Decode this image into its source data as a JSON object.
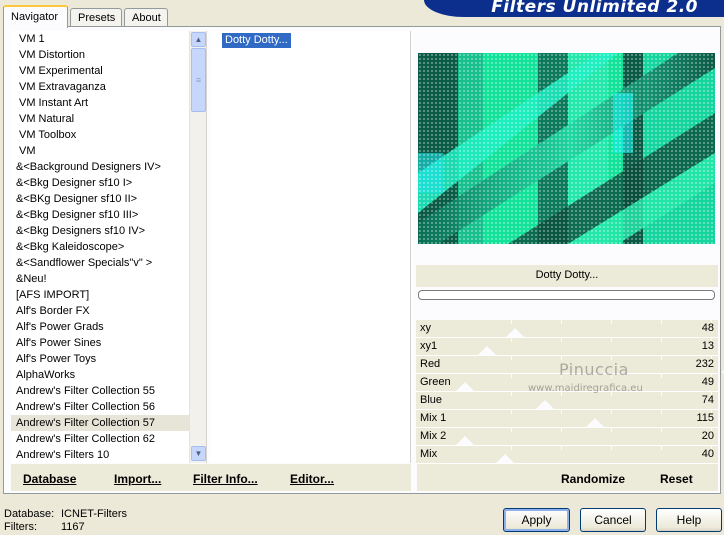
{
  "app": {
    "title": "Filters Unlimited 2.0"
  },
  "tabs": [
    {
      "label": "Navigator",
      "active": true
    },
    {
      "label": "Presets",
      "active": false
    },
    {
      "label": "About",
      "active": false
    }
  ],
  "categories": [
    "VM 1",
    "VM Distortion",
    "VM Experimental",
    "VM Extravaganza",
    "VM Instant Art",
    "VM Natural",
    "VM Toolbox",
    "VM",
    "&<Background Designers IV>",
    "&<Bkg Designer sf10 I>",
    "&<BKg Designer sf10 II>",
    "&<Bkg Designer sf10 III>",
    "&<Bkg Designers sf10 IV>",
    "&<Bkg Kaleidoscope>",
    "&<Sandflower Specials\"v\" >",
    "&Neu!",
    "[AFS IMPORT]",
    "Alf's Border FX",
    "Alf's Power Grads",
    "Alf's Power Sines",
    "Alf's Power Toys",
    "AlphaWorks",
    "Andrew's Filter Collection 55",
    "Andrew's Filter Collection 56",
    "Andrew's Filter Collection 57",
    "Andrew's Filter Collection 62",
    "Andrew's Filters 10"
  ],
  "selected_category": "Andrew's Filter Collection 57",
  "filters": [
    "Dotty Dotty..."
  ],
  "selected_filter": "Dotty Dotty...",
  "preview": {
    "filter_name": "Dotty Dotty...",
    "progress": 0
  },
  "parameters": [
    {
      "name": "xy",
      "value": 48
    },
    {
      "name": "xy1",
      "value": 13
    },
    {
      "name": "Red",
      "value": 232
    },
    {
      "name": "Green",
      "value": 49
    },
    {
      "name": "Blue",
      "value": 74
    },
    {
      "name": "Mix 1",
      "value": 115
    },
    {
      "name": "Mix 2",
      "value": 20
    },
    {
      "name": "Mix",
      "value": 40
    }
  ],
  "watermark": {
    "name": "Pinuccia",
    "url": "www.maidiregrafica.eu"
  },
  "links": {
    "database": "Database",
    "import": "Import...",
    "filter_info": "Filter Info...",
    "editor": "Editor...",
    "randomize": "Randomize",
    "reset": "Reset"
  },
  "status": {
    "database_label": "Database:",
    "database_value": "ICNET-Filters",
    "filters_label": "Filters:",
    "filters_value": "1167"
  },
  "buttons": {
    "apply": "Apply",
    "cancel": "Cancel",
    "help": "Help"
  },
  "colors": {
    "banner": "#0c2f8e",
    "selection": "#316ac5",
    "panel": "#ecead8",
    "preview_teal": "#12e29a"
  },
  "icons": {
    "scroll_up": "chevron-up-icon",
    "scroll_down": "chevron-down-icon"
  }
}
